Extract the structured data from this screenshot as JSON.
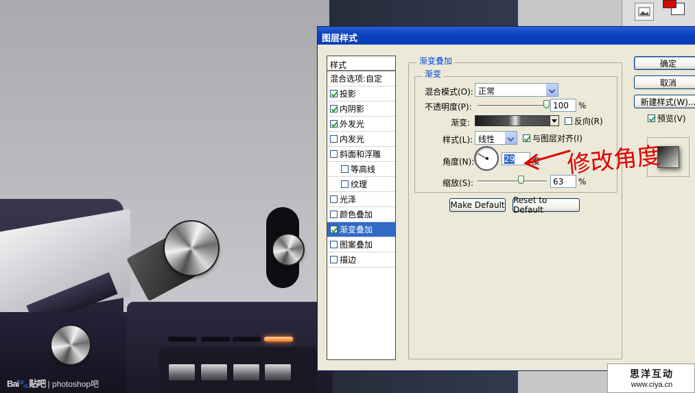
{
  "watermark_left": {
    "brand": "Bai",
    "brand2": "贴吧",
    "separator": "|",
    "text": "photoshop吧"
  },
  "watermark_right": {
    "title": "思洋互动",
    "url": "www.ciya.cn"
  },
  "dialog": {
    "title": "图层样式",
    "style_list": {
      "header": "样式",
      "items": [
        {
          "label": "混合选项:自定",
          "has_checkbox": false,
          "checked": false
        },
        {
          "label": "投影",
          "has_checkbox": true,
          "checked": true
        },
        {
          "label": "内阴影",
          "has_checkbox": true,
          "checked": true
        },
        {
          "label": "外发光",
          "has_checkbox": true,
          "checked": true
        },
        {
          "label": "内发光",
          "has_checkbox": true,
          "checked": false
        },
        {
          "label": "斜面和浮雕",
          "has_checkbox": true,
          "checked": false
        },
        {
          "label": "等高线",
          "has_checkbox": true,
          "checked": false
        },
        {
          "label": "纹理",
          "has_checkbox": true,
          "checked": false
        },
        {
          "label": "光泽",
          "has_checkbox": true,
          "checked": false
        },
        {
          "label": "颜色叠加",
          "has_checkbox": true,
          "checked": false
        },
        {
          "label": "渐变叠加",
          "has_checkbox": true,
          "checked": true,
          "selected": true
        },
        {
          "label": "图案叠加",
          "has_checkbox": true,
          "checked": false
        },
        {
          "label": "描边",
          "has_checkbox": true,
          "checked": false
        }
      ]
    },
    "section_title": "渐变叠加",
    "group_title": "渐变",
    "blend_mode": {
      "label": "混合模式(O):",
      "value": "正常"
    },
    "opacity": {
      "label": "不透明度(P):",
      "value": "100",
      "unit": "%",
      "level": 100
    },
    "gradient": {
      "label": "渐变:"
    },
    "reverse": {
      "label": "反向(R)",
      "checked": false
    },
    "style": {
      "label": "样式(L):",
      "value": "线性"
    },
    "align": {
      "label": "与图层对齐(I)",
      "checked": true
    },
    "angle": {
      "label": "角度(N):",
      "value": "29",
      "unit": "度"
    },
    "scale": {
      "label": "缩放(S):",
      "value": "63",
      "unit": "%",
      "level": 63
    },
    "make_default": "Make Default",
    "reset_default": "Reset to Default",
    "ok": "确定",
    "cancel": "取消",
    "new_style": "新建样式(W)...",
    "preview": {
      "label": "预览(V)",
      "checked": true
    }
  },
  "annotation": {
    "text": "修改角度",
    "color": "#e00000"
  },
  "colors": {
    "title_bar": "#0b3fbd",
    "selection": "#316ac5",
    "dialog_bg": "#ece9d8",
    "group_title": "#0046d5"
  }
}
